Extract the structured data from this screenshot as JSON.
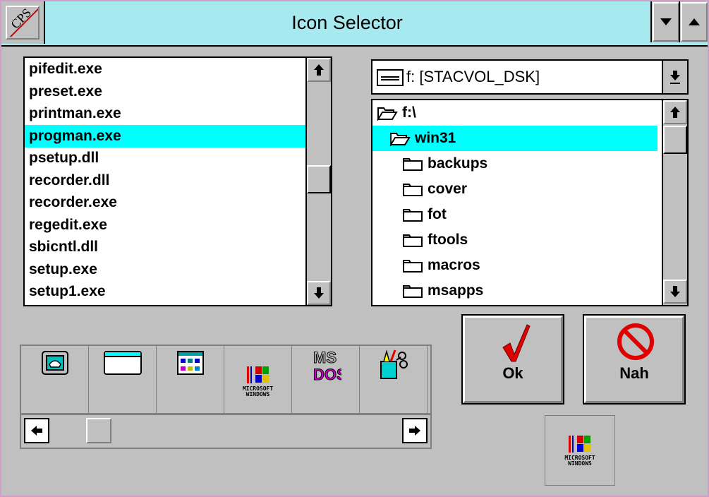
{
  "window": {
    "title": "Icon Selector",
    "sysmenu_label": "CPS"
  },
  "file_list": {
    "items": [
      "pifedit.exe",
      "preset.exe",
      "printman.exe",
      "progman.exe",
      "psetup.dll",
      "recorder.dll",
      "recorder.exe",
      "regedit.exe",
      "sbicntl.dll",
      "setup.exe",
      "setup1.exe"
    ],
    "selected": "progman.exe"
  },
  "drive": {
    "value": "f: [STACVOL_DSK]"
  },
  "dir_list": {
    "items": [
      {
        "label": "f:\\",
        "level": 0,
        "open": true
      },
      {
        "label": "win31",
        "level": 1,
        "open": true
      },
      {
        "label": "backups",
        "level": 2,
        "open": false
      },
      {
        "label": "cover",
        "level": 2,
        "open": false
      },
      {
        "label": "fot",
        "level": 2,
        "open": false
      },
      {
        "label": "ftools",
        "level": 2,
        "open": false
      },
      {
        "label": "macros",
        "level": 2,
        "open": false
      },
      {
        "label": "msapps",
        "level": 2,
        "open": false
      }
    ],
    "selected": "win31"
  },
  "icons": [
    "telephone-icon",
    "window-icon",
    "control-panel-icon",
    "windows-logo-icon",
    "ms-dos-icon",
    "paint-cup-icon"
  ],
  "windows_logo_text": [
    "MICROSOFT",
    "WINDOWS"
  ],
  "ms_dos_text": [
    "MS",
    "DOS"
  ],
  "buttons": {
    "ok": "Ok",
    "cancel": "Nah"
  },
  "colors": {
    "title_bg": "#a6e9ee",
    "selection": "#00ffff",
    "face": "#c0c0c0"
  }
}
